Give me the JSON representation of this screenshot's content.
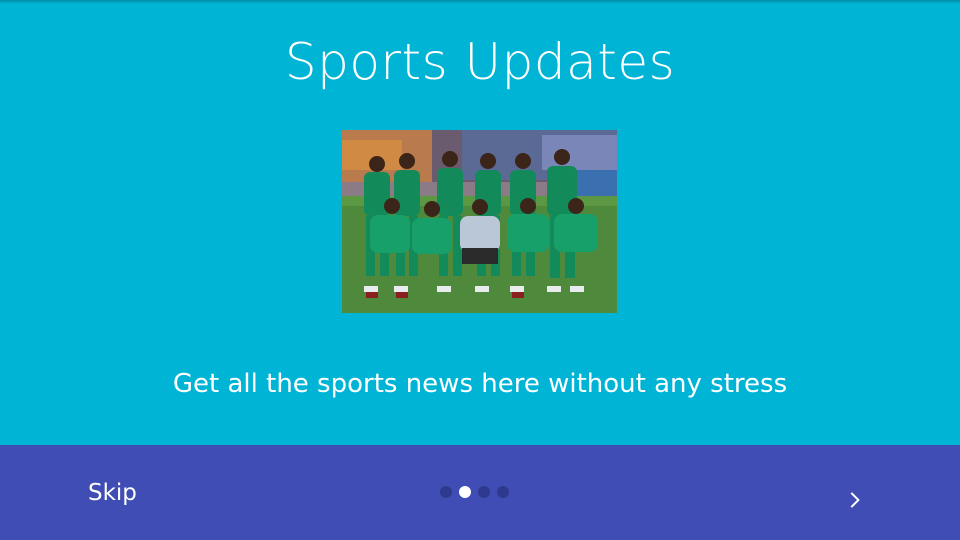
{
  "slide": {
    "title": "Sports Updates",
    "image_alt": "team-photo",
    "description": "Get all the sports news here without any stress"
  },
  "footer": {
    "skip_label": "Skip",
    "pager": {
      "total": 4,
      "active_index": 1
    },
    "next_icon": "chevron-right-icon"
  },
  "colors": {
    "background": "#00B4D5",
    "bottom_bar": "#3F4DB5",
    "dot_inactive": "#2E3A8E",
    "dot_active": "#FFFFFF",
    "text": "#FFFFFF"
  }
}
